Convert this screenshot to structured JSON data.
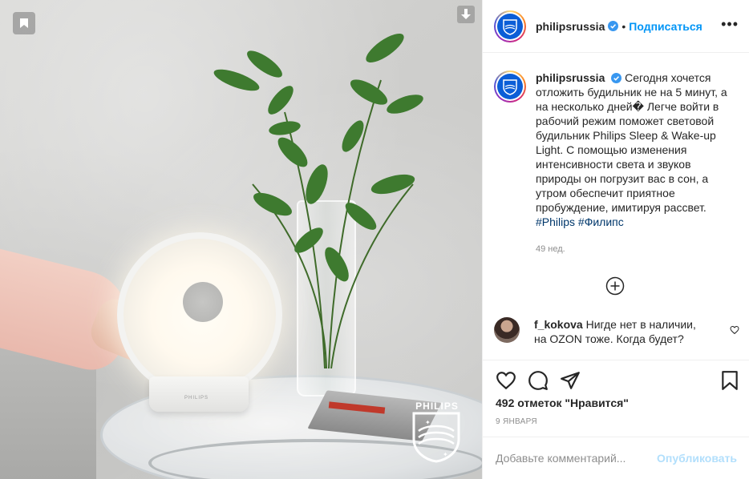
{
  "account": {
    "username": "philipsrussіa",
    "verified": true,
    "follow_label": "Подписаться",
    "separator": "•",
    "more_label": "•••"
  },
  "caption": {
    "username": "philipsrussia",
    "text": "Сегодня хочется отложить будильник не на 5 минут, а на несколько дней� Легче войти в рабочий режим поможет световой будильник Philips Sleep & Wake-up Light. С помощью изменения интенсивности света и звуков природы он погрузит вас в сон, а утром обеспечит приятное пробуждение, имитируя рассвет.",
    "hashtags": [
      "#Philips",
      "#Филипс"
    ],
    "time_ago": "49 нед."
  },
  "comments": [
    {
      "username": "f_kokova",
      "text": "Нигде нет в наличии, на OZON тоже. Когда будет?"
    }
  ],
  "likes_label": "492 отметок \"Нравится\"",
  "date_label": "9 ЯНВАРЯ",
  "add_comment": {
    "placeholder": "Добавьте комментарий...",
    "post_label": "Опубликовать"
  },
  "media": {
    "brand_watermark": "PHILIPS",
    "lamp_label": "PHILIPS",
    "description_icons": [
      "bookmark-badge-icon",
      "download-icon"
    ]
  },
  "colors": {
    "link": "#0095f6",
    "hashtag": "#00376b",
    "post_disabled": "#b2dffc",
    "philips_blue": "#0b5ed7"
  }
}
